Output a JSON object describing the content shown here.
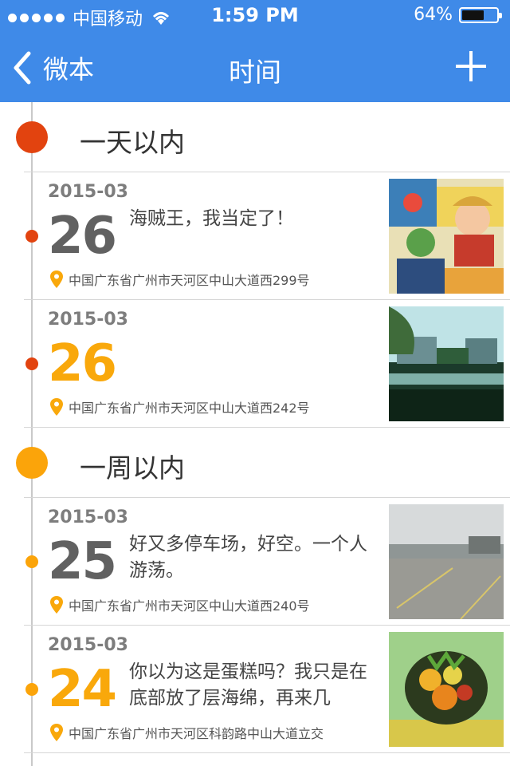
{
  "status_bar": {
    "carrier": "中国移动",
    "time": "1:59 PM",
    "battery_percent": "64%",
    "battery_level": 0.64
  },
  "nav": {
    "back_label": "微本",
    "title": "时间",
    "add_icon": "plus-icon"
  },
  "colors": {
    "header": "#3f8ae8",
    "section_today": "#e2430f",
    "section_week": "#fba40a",
    "day_gray": "#616161",
    "day_orange": "#f9a80b"
  },
  "sections": [
    {
      "title": "一天以内",
      "entries": [
        {
          "month": "2015-03",
          "day": "26",
          "text": "海贼王，我当定了！",
          "location": "中国广东省广州市天河区中山大道西299号",
          "photo": "anime-poster"
        },
        {
          "month": "2015-03",
          "day": "26",
          "text": "",
          "location": "中国广东省广州市天河区中山大道西242号",
          "photo": "lake-buildings"
        }
      ]
    },
    {
      "title": "一周以内",
      "entries": [
        {
          "month": "2015-03",
          "day": "25",
          "text": "好又多停车场，好空。一个人游荡。",
          "location": "中国广东省广州市天河区中山大道西240号",
          "photo": "parking-lot"
        },
        {
          "month": "2015-03",
          "day": "24",
          "text": "你以为这是蛋糕吗？我只是在底部放了层海绵，再来几",
          "location": "中国广东省广州市天河区科韵路中山大道立交",
          "photo": "fruit-cake"
        }
      ]
    }
  ]
}
